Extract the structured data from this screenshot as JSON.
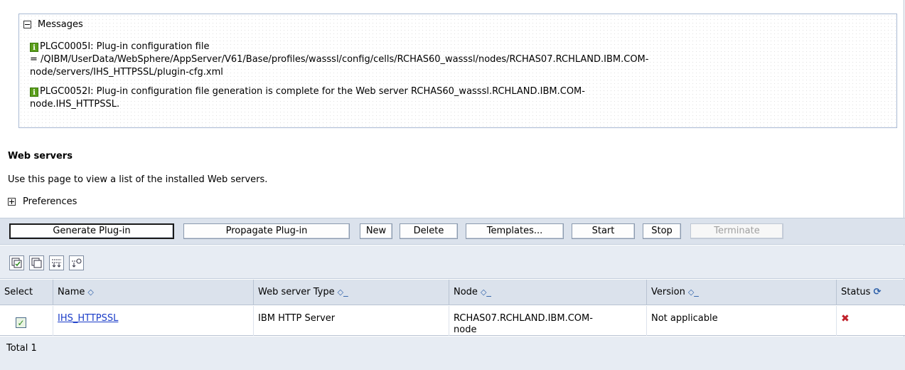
{
  "messages": {
    "title": "Messages",
    "items": [
      {
        "icon": "info-icon",
        "lines": [
          "PLGC0005I: Plug-in configuration file",
          "= /QIBM/UserData/WebSphere/AppServer/V61/Base/profiles/wasssl/config/cells/RCHAS60_wasssl/nodes/RCHAS07.RCHLAND.IBM.COM-",
          "node/servers/IHS_HTTPSSL/plugin-cfg.xml"
        ]
      },
      {
        "icon": "info-icon",
        "lines": [
          "PLGC0052I: Plug-in configuration file generation is complete for the Web server RCHAS60_wasssl.RCHLAND.IBM.COM-",
          "node.IHS_HTTPSSL."
        ]
      }
    ]
  },
  "page": {
    "title": "Web servers",
    "description": "Use this page to view a list of the installed Web servers.",
    "preferences_label": "Preferences"
  },
  "toolbar": {
    "generate_plugin": "Generate Plug-in",
    "propagate_plugin": "Propagate Plug-in",
    "new": "New",
    "delete": "Delete",
    "templates": "Templates...",
    "start": "Start",
    "stop": "Stop",
    "terminate": "Terminate"
  },
  "icon_toolbar": [
    "select-all-icon",
    "deselect-all-icon",
    "show-filter-icon",
    "clear-filter-icon"
  ],
  "table": {
    "headers": {
      "select": "Select",
      "name": "Name",
      "type": "Web server Type",
      "node": "Node",
      "version": "Version",
      "status": "Status"
    },
    "rows": [
      {
        "selected": true,
        "name": "IHS_HTTPSSL",
        "type": "IBM HTTP Server",
        "node_line1": "RCHAS07.RCHLAND.IBM.COM-",
        "node_line2": "node",
        "version": "Not applicable",
        "status_icon": "stopped-x-icon"
      }
    ],
    "total": "Total 1"
  },
  "colors": {
    "link": "#1a3cc8",
    "header_bg": "#dbe2ec",
    "info_green": "#5a9d1a",
    "status_red": "#c0202a"
  }
}
